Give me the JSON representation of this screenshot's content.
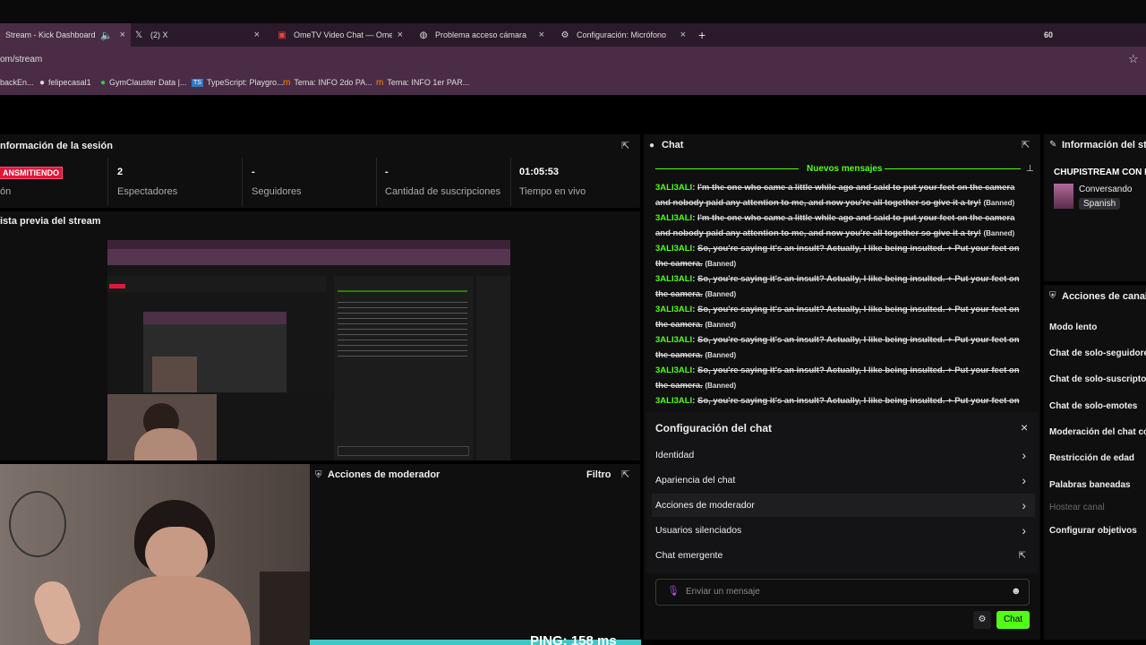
{
  "browser": {
    "tabs": [
      {
        "label": "Stream - Kick Dashboard",
        "icon": "speaker-icon"
      },
      {
        "label": "(2) X",
        "icon": "x-logo-icon"
      },
      {
        "label": "OmeTV Video Chat — Omegle",
        "icon": "ometv-icon"
      },
      {
        "label": "Problema acceso cámara",
        "icon": "globe-icon"
      },
      {
        "label": "Configuración: Micrófono",
        "icon": "gear-icon"
      }
    ],
    "tab_count": "60",
    "url": "om/stream",
    "bookmarks": [
      {
        "label": "backEn..."
      },
      {
        "label": "felipecasal1"
      },
      {
        "label": "GymClauster Data |..."
      },
      {
        "label": "TypeScript: Playgro..."
      },
      {
        "label": "Tema: INFO 2do PA..."
      },
      {
        "label": "Tema: INFO 1er PAR..."
      }
    ]
  },
  "session": {
    "title": "nformación de la sesión",
    "status_badge": "ANSMITIENDO",
    "status_label": "ón",
    "stats": [
      {
        "value": "2",
        "label": "Espectadores"
      },
      {
        "value": "-",
        "label": "Seguidores"
      },
      {
        "value": "-",
        "label": "Cantidad de suscripciones"
      },
      {
        "value": "01:05:53",
        "label": "Tiempo en vivo"
      }
    ]
  },
  "preview": {
    "title": "ista previa del stream"
  },
  "moderator": {
    "title": "Acciones de moderador",
    "filter_label": "Filtro"
  },
  "chat": {
    "title": "Chat",
    "new_messages_label": "Nuevos mensajes",
    "messages": [
      {
        "user": "3ALI3ALI",
        "text": "I'm the one who came a little while ago and said to put your feet on the camera and nobody paid any attention to me, and now you're all together so give it a try!",
        "tag": "(Banned)"
      },
      {
        "user": "3ALI3ALI",
        "text": "I'm the one who came a little while ago and said to put your feet on the camera and nobody paid any attention to me, and now you're all together so give it a try!",
        "tag": "(Banned)"
      },
      {
        "user": "3ALI3ALI",
        "text": "So, you're saying it's an insult? Actually, I like being insulted. + Put your feet on the camera.",
        "tag": "(Banned)"
      },
      {
        "user": "3ALI3ALI",
        "text": "So, you're saying it's an insult? Actually, I like being insulted. + Put your feet on the camera.",
        "tag": "(Banned)"
      },
      {
        "user": "3ALI3ALI",
        "text": "So, you're saying it's an insult? Actually, I like being insulted. + Put your feet on the camera.",
        "tag": "(Banned)"
      },
      {
        "user": "3ALI3ALI",
        "text": "So, you're saying it's an insult? Actually, I like being insulted. + Put your feet on the camera.",
        "tag": "(Banned)"
      },
      {
        "user": "3ALI3ALI",
        "text": "So, you're saying it's an insult? Actually, I like being insulted. + Put your feet on the camera.",
        "tag": "(Banned)"
      },
      {
        "user": "3ALI3ALI",
        "text": "So, you're saying it's an insult? Actually, I like being insulted. + Put your feet on the",
        "tag": ""
      }
    ],
    "config": {
      "title": "Configuración del chat",
      "items": [
        {
          "label": "Identidad"
        },
        {
          "label": "Apariencia del chat"
        },
        {
          "label": "Acciones de moderador"
        },
        {
          "label": "Usuarios silenciados"
        },
        {
          "label": "Chat emergente"
        }
      ]
    },
    "input_placeholder": "Enviar un mensaje",
    "send_label": "Chat"
  },
  "stream_info": {
    "title": "Información del strea",
    "stream_title": "CHUPISTREAM CON LO",
    "category": "Conversando",
    "language": "Spanish"
  },
  "channel_actions": {
    "title": "Acciones de canal",
    "items": [
      {
        "label": "Modo lento"
      },
      {
        "label": "Chat de solo-seguidores"
      },
      {
        "label": "Chat de solo-suscriptore"
      },
      {
        "label": "Chat de solo-emotes"
      },
      {
        "label": "Moderación del chat co"
      },
      {
        "label": "Restricción de edad"
      },
      {
        "label": "Palabras baneadas"
      },
      {
        "label": "Hostear canal"
      },
      {
        "label": "Configurar objetivos"
      }
    ]
  },
  "overlay_text": "PING: 158 ms",
  "colors": {
    "accent": "#53fc18",
    "badge_red": "#e0173b",
    "tab_bg": "#2b1a2a",
    "urlbar_bg": "#4a2c46"
  }
}
